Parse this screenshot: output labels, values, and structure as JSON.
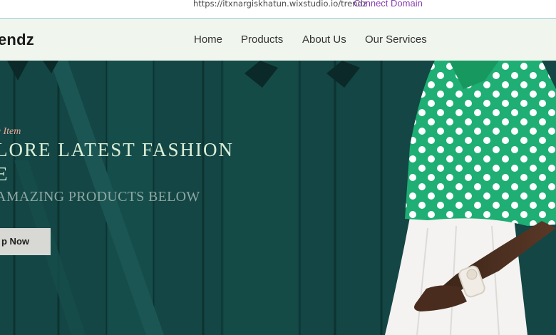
{
  "browser": {
    "url": "https://itxnargiskhatun.wixstudio.io/trendz",
    "connect_domain": "Connect Domain"
  },
  "header": {
    "logo": "endz",
    "nav": [
      "Home",
      "Products",
      "About Us",
      "Our Services"
    ]
  },
  "hero": {
    "tag": "g Item",
    "headline_line1": "LORE LATEST FASHION",
    "headline_line2": "E",
    "subheading": "AMAZING PRODUCTS BELOW",
    "cta_label": "p Now"
  },
  "colors": {
    "header_bg": "#f0f6ee",
    "hero_teal": "#154a48",
    "headline": "#dcefd8",
    "tag": "#e8a99a",
    "connect_link": "#8a3fb3",
    "shirt_green": "#1fae74"
  }
}
